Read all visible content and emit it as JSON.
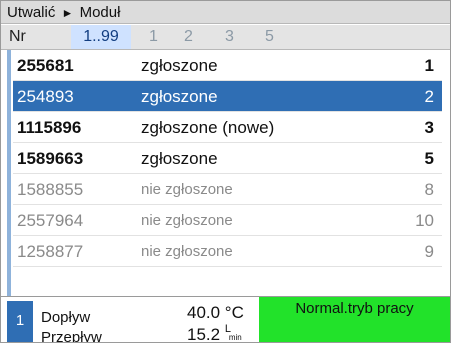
{
  "breadcrumb": {
    "parent": "Utwalić",
    "separator": "►",
    "current": "Moduł"
  },
  "tabs": {
    "nr_label": "Nr",
    "active": "1..99",
    "items": [
      "1",
      "2",
      "3",
      "5"
    ]
  },
  "rows": [
    {
      "nr": "255681",
      "status": "zgłoszone",
      "count": "1",
      "state": "normal"
    },
    {
      "nr": "254893",
      "status": "zgłoszone",
      "count": "2",
      "state": "selected"
    },
    {
      "nr": "1115896",
      "status": "zgłoszone (nowe)",
      "count": "3",
      "state": "normal"
    },
    {
      "nr": "1589663",
      "status": "zgłoszone",
      "count": "5",
      "state": "normal"
    },
    {
      "nr": "1588855",
      "status": "nie zgłoszone",
      "count": "8",
      "state": "dim"
    },
    {
      "nr": "2557964",
      "status": "nie zgłoszone",
      "count": "10",
      "state": "dim"
    },
    {
      "nr": "1258877",
      "status": "nie zgłoszone",
      "count": "9",
      "state": "dim"
    }
  ],
  "status_bar": {
    "index": "1",
    "inflow_label": "Dopływ",
    "inflow_value": "40.0 °C",
    "flow_label": "Przepływ",
    "flow_value": "15.2",
    "flow_unit_top": "L",
    "flow_unit_bottom": "min",
    "mode": "Normal.tryb pracy",
    "mode_color": "#22e22a"
  }
}
